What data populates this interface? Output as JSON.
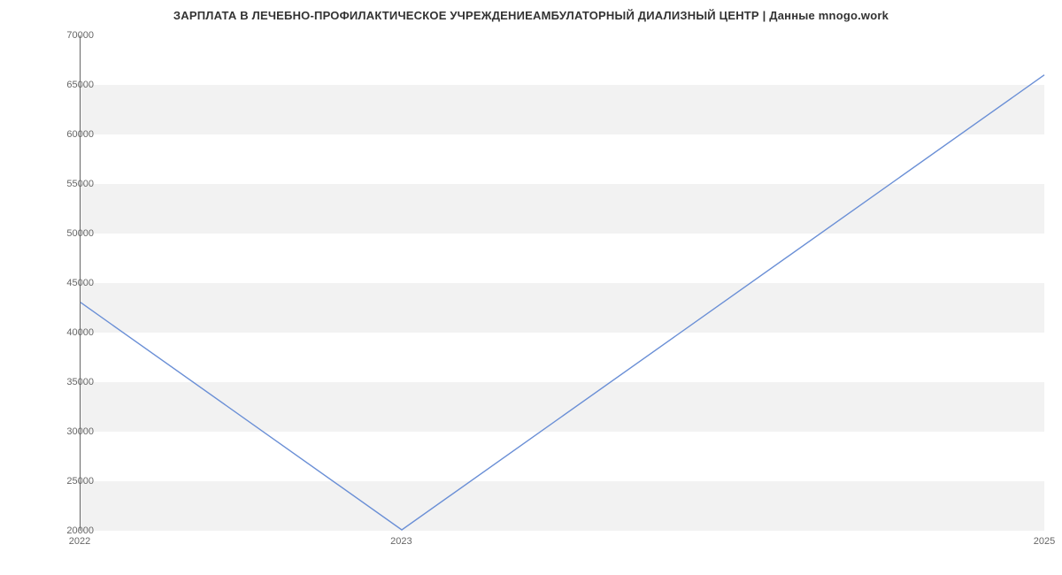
{
  "chart_data": {
    "type": "line",
    "title": "ЗАРПЛАТА В ЛЕЧЕБНО-ПРОФИЛАКТИЧЕСКОЕ УЧРЕЖДЕНИЕАМБУЛАТОРНЫЙ ДИАЛИЗНЫЙ ЦЕНТР | Данные mnogo.work",
    "x": [
      2022,
      2023,
      2025
    ],
    "values": [
      43000,
      20000,
      66000
    ],
    "x_ticks": [
      2022,
      2023,
      2025
    ],
    "y_ticks": [
      20000,
      25000,
      30000,
      35000,
      40000,
      45000,
      50000,
      55000,
      60000,
      65000,
      70000
    ],
    "xlim": [
      2022,
      2025
    ],
    "ylim": [
      20000,
      70000
    ],
    "xlabel": "",
    "ylabel": "",
    "series_color": "#6a8fd6",
    "grid": "horizontal-bands"
  }
}
